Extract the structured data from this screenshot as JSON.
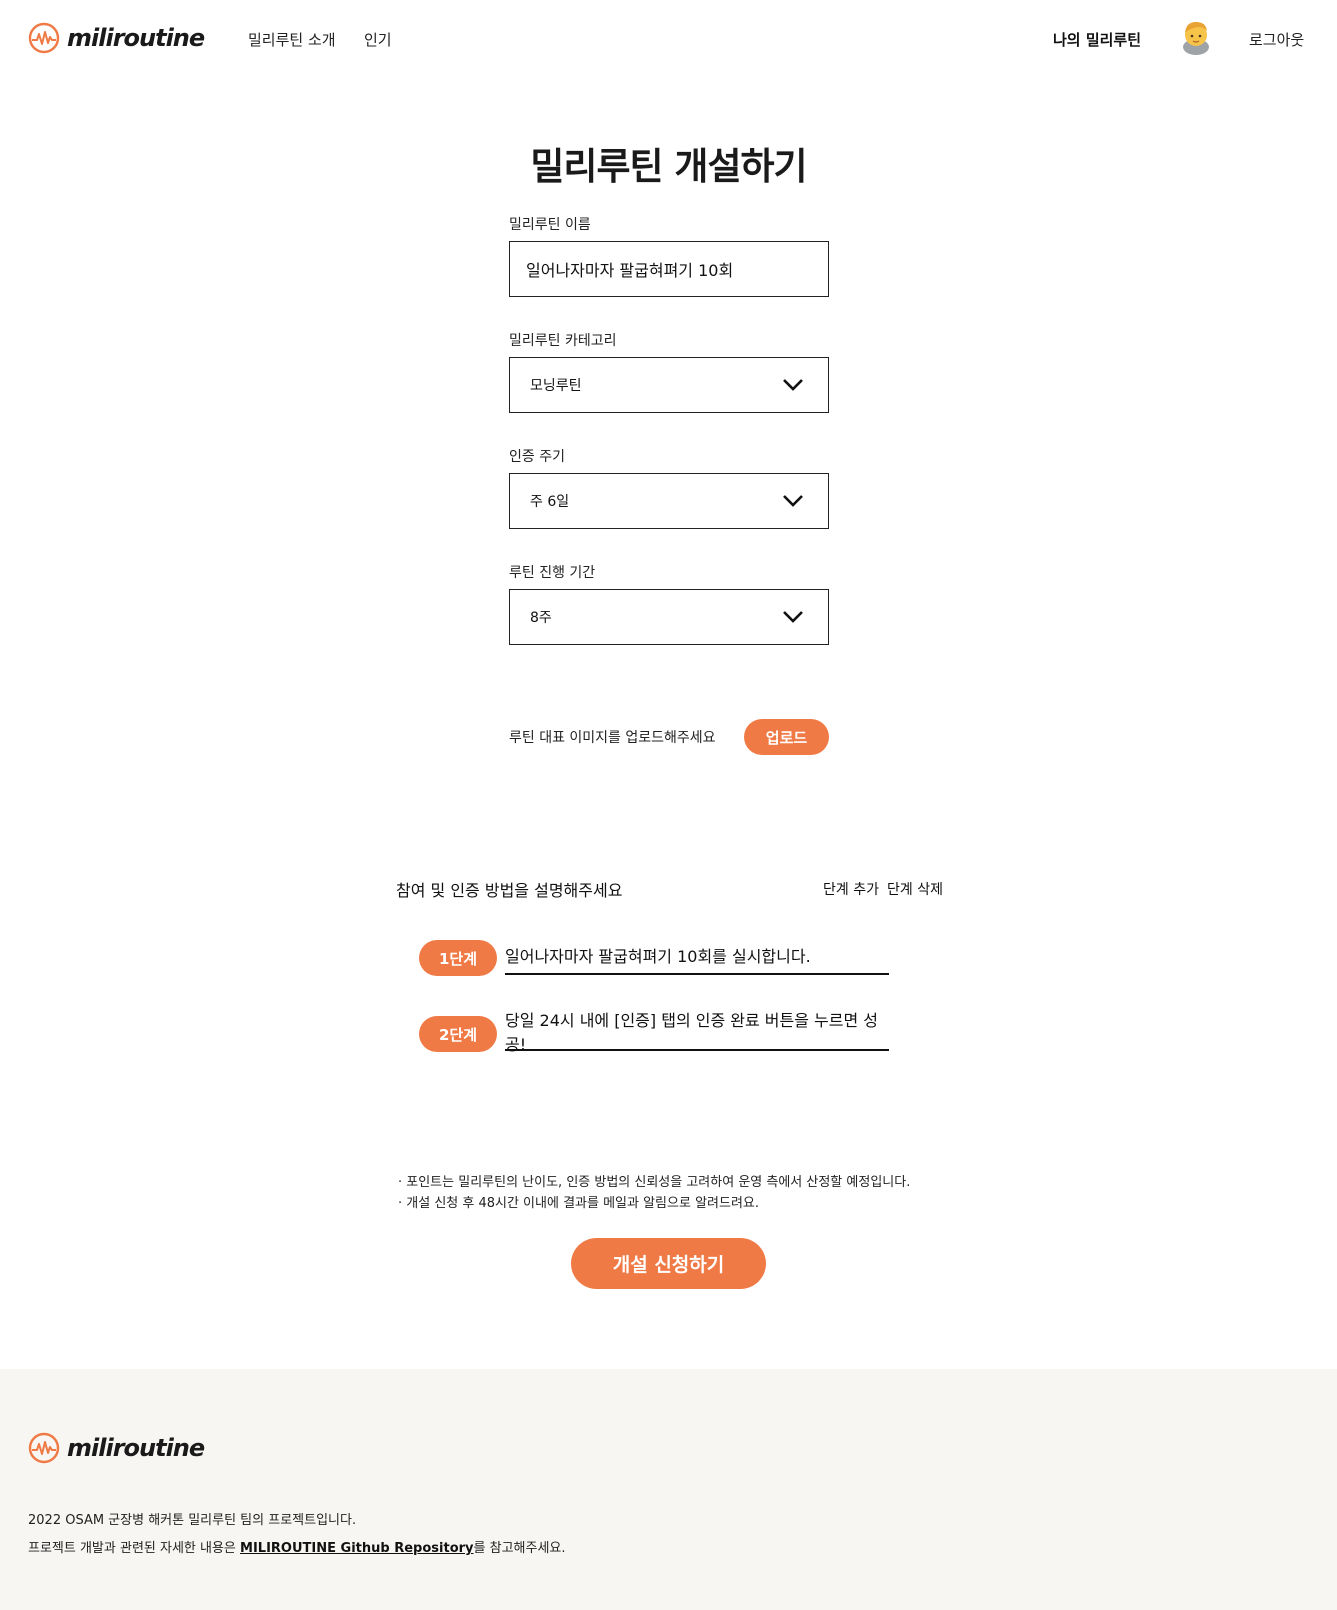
{
  "header": {
    "logo_text": "miliroutine",
    "nav": [
      "밀리루틴 소개",
      "인기"
    ],
    "my_routine": "나의 밀리루틴",
    "logout": "로그아웃"
  },
  "page": {
    "title": "밀리루틴 개설하기"
  },
  "form": {
    "name_label": "밀리루틴 이름",
    "name_value": "일어나자마자 팔굽혀펴기 10회",
    "category_label": "밀리루틴 카테고리",
    "category_value": "모닝루틴",
    "cycle_label": "인증 주기",
    "cycle_value": "주 6일",
    "period_label": "루틴 진행 기간",
    "period_value": "8주",
    "upload_label": "루틴 대표 이미지를 업로드해주세요",
    "upload_button": "업로드"
  },
  "steps": {
    "title": "참여 및 인증 방법을 설명해주세요",
    "add": "단계 추가",
    "delete": "단계 삭제",
    "items": [
      {
        "badge": "1단계",
        "text": "일어나자마자 팔굽혀펴기 10회를 실시합니다."
      },
      {
        "badge": "2단계",
        "text": "당일 24시 내에 [인증] 탭의 인증 완료 버튼을 누르면 성공!"
      }
    ]
  },
  "notes": [
    "· 포인트는 밀리루틴의 난이도, 인증 방법의 신뢰성을 고려하여 운영 측에서 산정할 예정입니다.",
    "· 개설 신청 후 48시간 이내에 결과를 메일과 알림으로 알려드려요."
  ],
  "submit_button": "개설 신청하기",
  "footer": {
    "logo_text": "miliroutine",
    "line1": "2022 OSAM 군장병 해커톤 밀리루틴 팀의 프로젝트입니다.",
    "line2_prefix": "프로젝트 개발과 관련된 자세한 내용은 ",
    "line2_link": "MILIROUTINE Github Repository",
    "line2_suffix": "를 참고해주세요."
  },
  "colors": {
    "accent": "#f07a45",
    "footer_bg": "#f8f6f2"
  },
  "icons": {
    "logo": "heartbeat-circle-icon",
    "avatar": "user-avatar-emoji",
    "select": "chevron-down-icon"
  }
}
